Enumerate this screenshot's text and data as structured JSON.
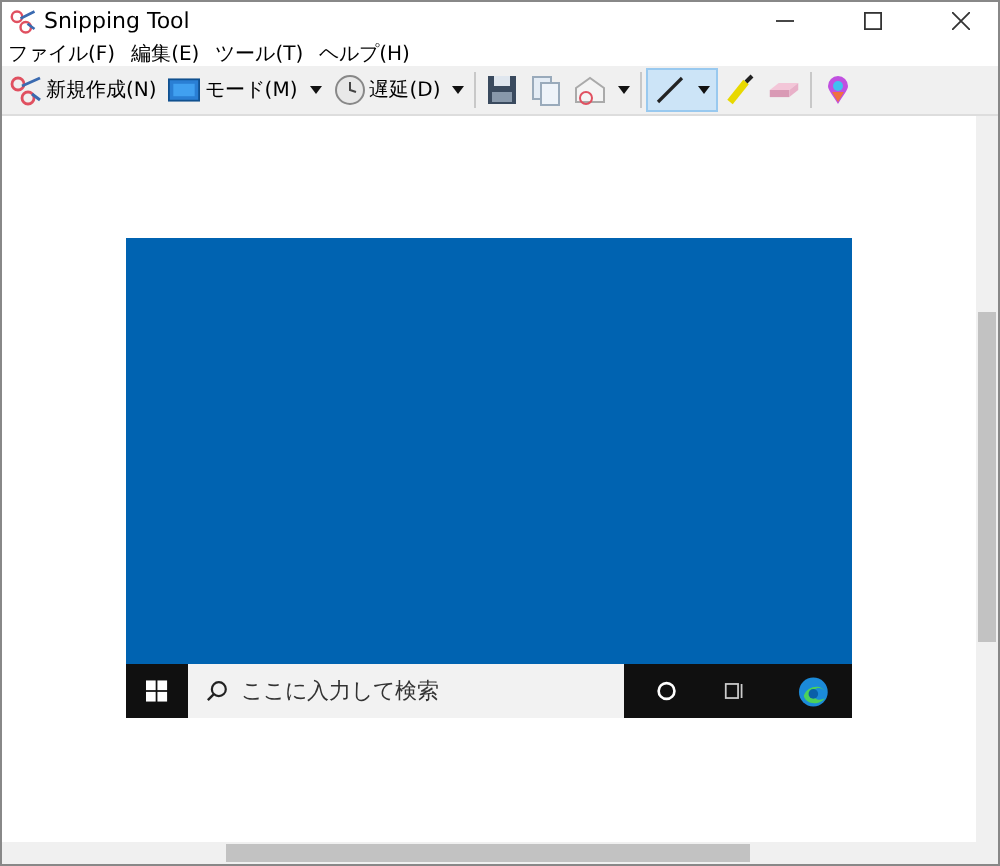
{
  "window": {
    "title": "Snipping Tool"
  },
  "menu": [
    "ファイル(F)",
    "編集(E)",
    "ツール(T)",
    "ヘルプ(H)"
  ],
  "toolbar": [
    {
      "kind": "new",
      "label": "新規作成(N)"
    },
    {
      "kind": "mode",
      "label": "モード(M)",
      "dropdown": true
    },
    {
      "kind": "delay",
      "label": "遅延(D)",
      "dropdown": true
    },
    {
      "kind": "save"
    },
    {
      "kind": "copy"
    },
    {
      "kind": "send",
      "dropdown": true
    },
    {
      "kind": "pen",
      "dropdown": true,
      "selected": true
    },
    {
      "kind": "highlighter",
      "selected": false
    },
    {
      "kind": "eraser",
      "selected": false
    },
    {
      "kind": "paint3d"
    }
  ],
  "snip": {
    "taskbar": {
      "search": {
        "placeholder": "ここに入力して検索"
      }
    }
  }
}
